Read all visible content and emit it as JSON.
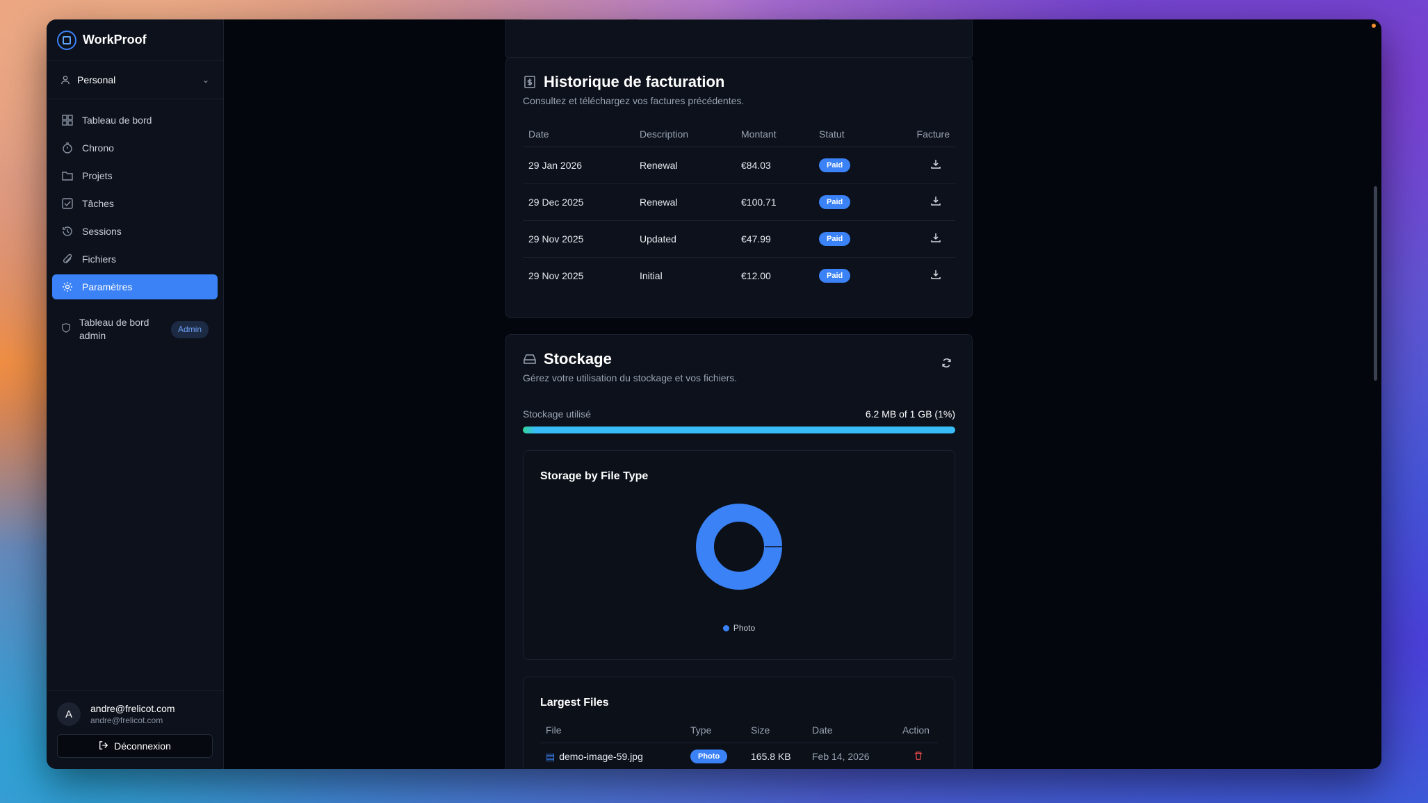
{
  "app": {
    "name": "WorkProof"
  },
  "workspace": {
    "label": "Personal"
  },
  "sidebar": {
    "items": [
      {
        "label": "Tableau de bord",
        "icon": "dashboard-icon"
      },
      {
        "label": "Chrono",
        "icon": "timer-icon"
      },
      {
        "label": "Projets",
        "icon": "folder-icon"
      },
      {
        "label": "Tâches",
        "icon": "checkbox-icon"
      },
      {
        "label": "Sessions",
        "icon": "history-icon"
      },
      {
        "label": "Fichiers",
        "icon": "paperclip-icon"
      },
      {
        "label": "Paramètres",
        "icon": "gear-icon"
      }
    ],
    "admin_label": "Tableau de bord admin",
    "admin_badge": "Admin"
  },
  "user": {
    "initial": "A",
    "name": "andre@frelicot.com",
    "email": "andre@frelicot.com",
    "logout_label": "Déconnexion"
  },
  "billing": {
    "title": "Historique de facturation",
    "subtitle": "Consultez et téléchargez vos factures précédentes.",
    "columns": [
      "Date",
      "Description",
      "Montant",
      "Statut",
      "Facture"
    ],
    "rows": [
      {
        "date": "29 Jan 2026",
        "description": "Renewal",
        "amount": "€84.03",
        "status": "Paid"
      },
      {
        "date": "29 Dec 2025",
        "description": "Renewal",
        "amount": "€100.71",
        "status": "Paid"
      },
      {
        "date": "29 Nov 2025",
        "description": "Updated",
        "amount": "€47.99",
        "status": "Paid"
      },
      {
        "date": "29 Nov 2025",
        "description": "Initial",
        "amount": "€12.00",
        "status": "Paid"
      }
    ]
  },
  "storage": {
    "title": "Stockage",
    "subtitle": "Gérez votre utilisation du stockage et vos fichiers.",
    "used_label": "Stockage utilisé",
    "used_value": "6.2 MB of 1 GB (1%)",
    "used_fraction": 0.01,
    "by_type_title": "Storage by File Type",
    "legend": [
      "Photo"
    ],
    "largest_title": "Largest Files",
    "largest_columns": [
      "File",
      "Type",
      "Size",
      "Date",
      "Action"
    ],
    "largest_rows": [
      {
        "file": "demo-image-59.jpg",
        "type": "Photo",
        "size": "165.8 KB",
        "date": "Feb 14, 2026"
      }
    ]
  },
  "colors": {
    "accent": "#3b82f6",
    "bar": "#38bdf8"
  }
}
